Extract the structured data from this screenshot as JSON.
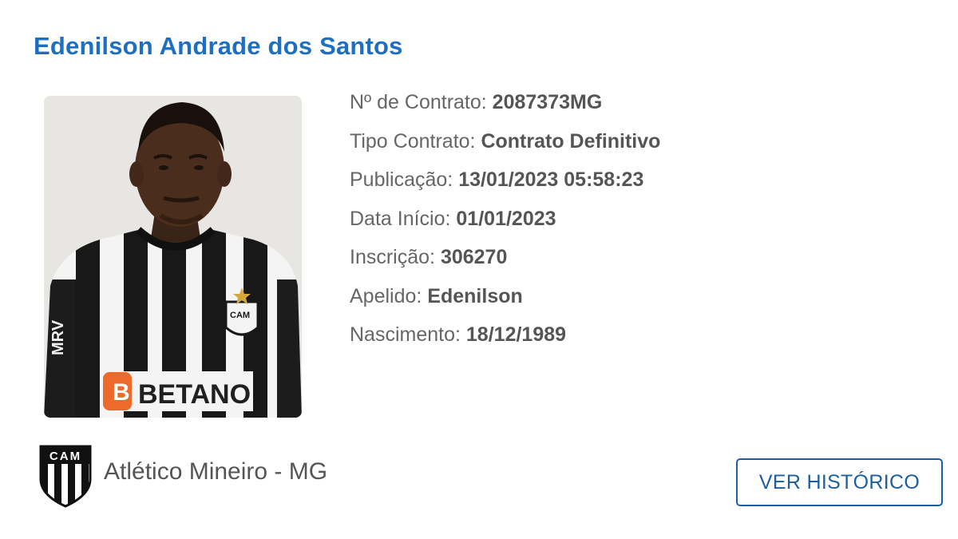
{
  "player": {
    "name": "Edenilson Andrade dos Santos"
  },
  "details": [
    {
      "label": "Nº de Contrato:",
      "value": "2087373MG"
    },
    {
      "label": "Tipo Contrato:",
      "value": "Contrato Definitivo"
    },
    {
      "label": "Publicação:",
      "value": "13/01/2023 05:58:23"
    },
    {
      "label": "Data Início:",
      "value": "01/01/2023"
    },
    {
      "label": "Inscrição:",
      "value": "306270"
    },
    {
      "label": "Apelido:",
      "value": "Edenilson"
    },
    {
      "label": "Nascimento:",
      "value": "18/12/1989"
    }
  ],
  "photo": {
    "jersey_sponsor": "BETANO",
    "jersey_crest": "CAM",
    "sleeve_sponsor": "MRV"
  },
  "club": {
    "name": "Atlético Mineiro - MG",
    "crest_text": "CAM",
    "crest_icon": "club-crest-icon"
  },
  "actions": {
    "history_label": "VER HISTÓRICO"
  },
  "colors": {
    "name_blue": "#1d6fc2",
    "button_blue": "#1d5f9e",
    "label_gray": "#666666"
  }
}
